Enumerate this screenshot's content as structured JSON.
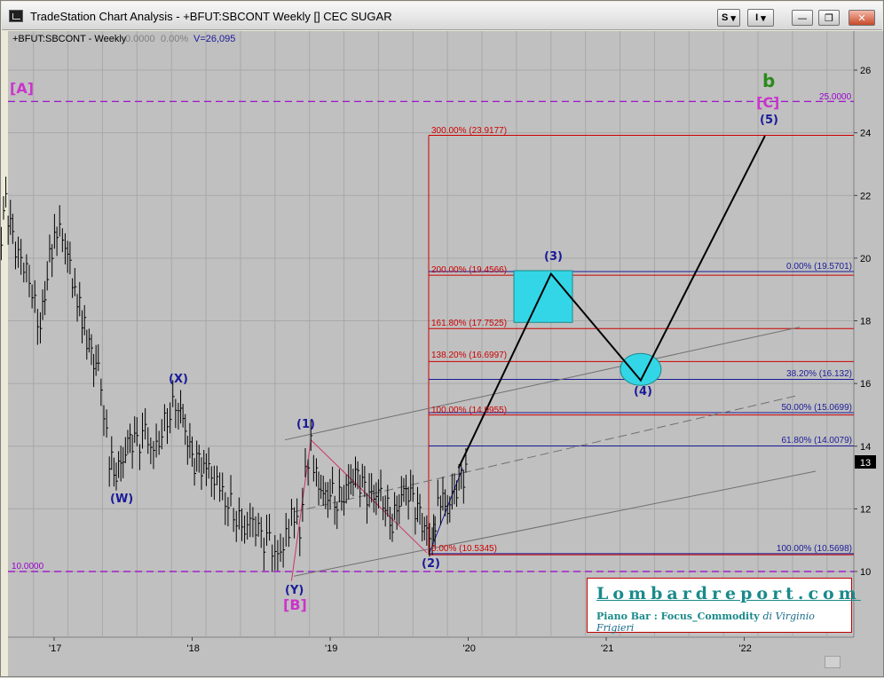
{
  "window": {
    "title": "TradeStation Chart Analysis - +BFUT:SBCONT Weekly [] CEC SUGAR",
    "buttons": {
      "s_label": "S",
      "i_label": "I",
      "minimize": "—",
      "restore": "❐",
      "close": "✕"
    }
  },
  "header": {
    "symbol": "+BFUT:SBCONT - Weekly",
    "val1": "0.0000",
    "val2": "0.00%",
    "volume": "V=26,095"
  },
  "price_axis": {
    "ticks": [
      "26",
      "24",
      "22",
      "20",
      "18",
      "16",
      "14",
      "12",
      "10"
    ],
    "last_price": "13"
  },
  "time_axis": {
    "ticks": [
      "'17",
      "'18",
      "'19",
      "'20",
      "'21",
      "'22"
    ]
  },
  "levels": {
    "top_line": "25.0000",
    "bottom_line": "10.0000",
    "ext": [
      {
        "label": "300.00% (23.9177)"
      },
      {
        "label": "200.00% (19.4566)"
      },
      {
        "label": "161.80% (17.7525)"
      },
      {
        "label": "138.20% (16.6997)"
      },
      {
        "label": "100.00% (14.9955)"
      },
      {
        "label": "0.00% (10.5345)"
      }
    ],
    "ret": [
      {
        "label": "0.00% (19.5701)"
      },
      {
        "label": "38.20% (16.132)"
      },
      {
        "label": "50.00% (15.0699)"
      },
      {
        "label": "61.80% (14.0079)"
      },
      {
        "label": "100.00% (10.5698)"
      }
    ]
  },
  "waves": {
    "A": "[A]",
    "B": "[B]",
    "C": "[C]",
    "W": "(W)",
    "X": "(X)",
    "Y": "(Y)",
    "w1": "(1)",
    "w2": "(2)",
    "w3": "(3)",
    "w4": "(4)",
    "w5": "(5)",
    "b": "b"
  },
  "branding": {
    "title": "Lombardreport.com",
    "subtitle": "Piano Bar : Focus_Commodity",
    "author": "di Virginio Frigieri"
  },
  "colors": {
    "purple": "#9900cc",
    "magenta": "#cc33cc",
    "navy": "#1a1a9a",
    "red": "#cc0000",
    "green": "#2a8a1a",
    "cyan": "#33d6e6",
    "teal": "#1a8a8a"
  },
  "chart_data": {
    "type": "line",
    "title": "",
    "xlabel": "",
    "ylabel": "",
    "ylim": [
      9.2,
      26.6
    ],
    "x_ticks": [
      "'17",
      "'18",
      "'19",
      "'20",
      "'21",
      "'22"
    ],
    "series": [
      {
        "values": [
          [
            2016.6,
            20.0
          ],
          [
            2016.65,
            21.8
          ],
          [
            2016.7,
            20.5
          ],
          [
            2016.8,
            19.6
          ],
          [
            2016.9,
            17.8
          ],
          [
            2016.95,
            19.6
          ],
          [
            2017.02,
            21.0
          ],
          [
            2017.08,
            20.5
          ],
          [
            2017.15,
            19.0
          ],
          [
            2017.22,
            17.8
          ],
          [
            2017.27,
            16.8
          ],
          [
            2017.32,
            16.5
          ],
          [
            2017.36,
            15.0
          ],
          [
            2017.4,
            13.6
          ],
          [
            2017.45,
            13.2
          ],
          [
            2017.5,
            13.6
          ],
          [
            2017.55,
            14.2
          ],
          [
            2017.6,
            14.0
          ],
          [
            2017.66,
            14.4
          ],
          [
            2017.72,
            13.8
          ],
          [
            2017.78,
            14.5
          ],
          [
            2017.84,
            15.2
          ],
          [
            2017.9,
            15.4
          ],
          [
            2017.95,
            14.5
          ],
          [
            2018.0,
            13.5
          ],
          [
            2018.05,
            13.4
          ],
          [
            2018.12,
            13.2
          ],
          [
            2018.2,
            12.6
          ],
          [
            2018.26,
            12.3
          ],
          [
            2018.32,
            11.8
          ],
          [
            2018.38,
            11.4
          ],
          [
            2018.44,
            11.6
          ],
          [
            2018.5,
            11.0
          ],
          [
            2018.56,
            10.9
          ],
          [
            2018.62,
            10.4
          ],
          [
            2018.66,
            10.8
          ],
          [
            2018.7,
            11.4
          ],
          [
            2018.74,
            11.9
          ],
          [
            2018.78,
            11.2
          ],
          [
            2018.82,
            13.2
          ],
          [
            2018.86,
            14.0
          ],
          [
            2018.9,
            13.0
          ],
          [
            2018.95,
            12.4
          ],
          [
            2019.0,
            12.6
          ],
          [
            2019.05,
            12.3
          ],
          [
            2019.1,
            12.5
          ],
          [
            2019.15,
            12.9
          ],
          [
            2019.2,
            13.0
          ],
          [
            2019.25,
            12.5
          ],
          [
            2019.3,
            12.3
          ],
          [
            2019.35,
            12.6
          ],
          [
            2019.4,
            12.2
          ],
          [
            2019.45,
            11.6
          ],
          [
            2019.5,
            12.3
          ],
          [
            2019.55,
            12.6
          ],
          [
            2019.6,
            12.2
          ],
          [
            2019.65,
            11.7
          ],
          [
            2019.7,
            11.2
          ],
          [
            2019.74,
            10.9
          ],
          [
            2019.76,
            11.6
          ],
          [
            2019.8,
            12.4
          ],
          [
            2019.85,
            12.0
          ],
          [
            2019.9,
            12.5
          ],
          [
            2019.95,
            12.9
          ],
          [
            2020.0,
            13.3
          ]
        ]
      }
    ],
    "projection": [
      [
        2019.93,
        13.3
      ],
      [
        2020.6,
        19.5
      ],
      [
        2021.25,
        16.1
      ],
      [
        2022.15,
        23.9
      ]
    ]
  }
}
